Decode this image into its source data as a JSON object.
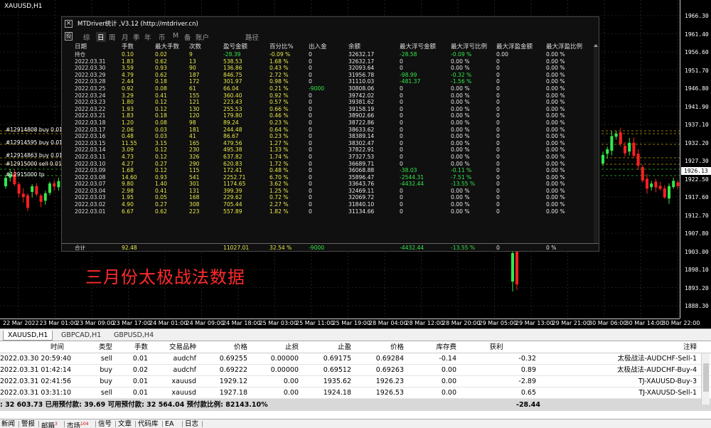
{
  "chart": {
    "symbol_title": "XAUUSD,H1",
    "caption": "三月份太极战法数据",
    "current_price": "1926.13",
    "price_ticks": [
      "1966.30",
      "1961.40",
      "1956.60",
      "1951.70",
      "1946.80",
      "1941.90",
      "1937.10",
      "1932.20",
      "1927.30",
      "1922.50",
      "1917.60",
      "1912.70",
      "1907.80",
      "1903.00",
      "1898.10",
      "1893.20",
      "1888.30"
    ],
    "time_ticks": [
      "22 Mar 2022",
      "23 Mar 01:00",
      "23 Mar 09:00",
      "23 Mar 17:00",
      "24 Mar 01:00",
      "24 Mar 09:00",
      "24 Mar 18:00",
      "25 Mar 03:00",
      "25 Mar 11:00",
      "25 Mar 19:00",
      "28 Mar 04:00",
      "28 Mar 12:00",
      "28 Mar 20:00",
      "29 Mar 05:00",
      "29 Mar 13:00",
      "29 Mar 21:00",
      "30 Mar 06:00",
      "30 Mar 14:00",
      "30 Mar 22:00"
    ],
    "order_labels": [
      "#12914808 buy 0.01",
      "#12914595 buy 0.01",
      "#12914863 buy 0.01",
      "#12915000 sell 0.01",
      "#12915000 tp"
    ]
  },
  "panel": {
    "title": "MTDriver统计 ,V3.12 (http://mtdriver.cn)",
    "side_box_top": "×",
    "side_box_tabs": "投",
    "tabs": [
      "综",
      "日",
      "周",
      "月",
      "季",
      "年",
      "币",
      "M",
      "备",
      "账户",
      "路径"
    ],
    "active_tab": "日",
    "headers": [
      "日期",
      "手数",
      "最大手数",
      "次数",
      "盈亏金额",
      "百分比%",
      "出入金",
      "余额",
      "最大浮亏金额",
      "最大浮亏比例",
      "最大浮盈金额",
      "最大浮盈比例"
    ],
    "rows": [
      [
        "持仓",
        "0.10",
        "0.02",
        "9",
        "-28.39",
        "-0.09 %",
        "0",
        "32632.17",
        "-28.58",
        "-0.09 %",
        "0.00",
        "0.00 %"
      ],
      [
        "2022.03.31",
        "1.83",
        "0.62",
        "13",
        "538.53",
        "1.68 %",
        "0",
        "32632.17",
        "0",
        "0.00 %",
        "0",
        "0.00 %"
      ],
      [
        "2022.03.30",
        "3.59",
        "0.93",
        "90",
        "136.86",
        "0.43 %",
        "0",
        "32093.64",
        "0",
        "0.00 %",
        "0",
        "0.00 %"
      ],
      [
        "2022.03.29",
        "4.79",
        "0.62",
        "187",
        "846.75",
        "2.72 %",
        "0",
        "31956.78",
        "-98.99",
        "-0.32 %",
        "0",
        "0.00 %"
      ],
      [
        "2022.03.28",
        "2.44",
        "0.18",
        "172",
        "301.97",
        "0.98 %",
        "0",
        "31110.03",
        "-481.37",
        "-1.56 %",
        "0",
        "0.00 %"
      ],
      [
        "2022.03.25",
        "0.92",
        "0.08",
        "61",
        "66.04",
        "0.21 %",
        "-9000",
        "30808.06",
        "0",
        "0.00 %",
        "0",
        "0.00 %"
      ],
      [
        "2022.03.24",
        "3.29",
        "0.41",
        "155",
        "360.40",
        "0.92 %",
        "0",
        "39742.02",
        "0",
        "0.00 %",
        "0",
        "0.00 %"
      ],
      [
        "2022.03.23",
        "1.80",
        "0.12",
        "121",
        "223.43",
        "0.57 %",
        "0",
        "39381.62",
        "0",
        "0.00 %",
        "0",
        "0.00 %"
      ],
      [
        "2022.03.22",
        "1.93",
        "0.12",
        "130",
        "255.53",
        "0.66 %",
        "0",
        "39158.19",
        "0",
        "0.00 %",
        "0",
        "0.00 %"
      ],
      [
        "2022.03.21",
        "1.83",
        "0.18",
        "120",
        "179.80",
        "0.46 %",
        "0",
        "38902.66",
        "0",
        "0.00 %",
        "0",
        "0.00 %"
      ],
      [
        "2022.03.18",
        "1.20",
        "0.08",
        "98",
        "89.24",
        "0.23 %",
        "0",
        "38722.86",
        "0",
        "0.00 %",
        "0",
        "0.00 %"
      ],
      [
        "2022.03.17",
        "2.06",
        "0.03",
        "181",
        "244.48",
        "0.64 %",
        "0",
        "38633.62",
        "0",
        "0.00 %",
        "0",
        "0.00 %"
      ],
      [
        "2022.03.16",
        "0.48",
        "0.03",
        "41",
        "86.67",
        "0.23 %",
        "0",
        "38389.14",
        "0",
        "0.00 %",
        "0",
        "0.00 %"
      ],
      [
        "2022.03.15",
        "11.55",
        "3.15",
        "165",
        "479.56",
        "1.27 %",
        "0",
        "38302.47",
        "0",
        "0.00 %",
        "0",
        "0.00 %"
      ],
      [
        "2022.03.14",
        "3.09",
        "0.12",
        "230",
        "495.38",
        "1.33 %",
        "0",
        "37822.91",
        "0",
        "0.00 %",
        "0",
        "0.00 %"
      ],
      [
        "2022.03.11",
        "4.73",
        "0.12",
        "326",
        "637.82",
        "1.74 %",
        "0",
        "37327.53",
        "0",
        "0.00 %",
        "0",
        "0.00 %"
      ],
      [
        "2022.03.10",
        "4.27",
        "0.27",
        "290",
        "620.83",
        "1.72 %",
        "0",
        "36689.71",
        "0",
        "0.00 %",
        "0",
        "0.00 %"
      ],
      [
        "2022.03.09",
        "1.68",
        "0.12",
        "115",
        "172.41",
        "0.48 %",
        "0",
        "36068.88",
        "-38.03",
        "-0.11 %",
        "0",
        "0.00 %"
      ],
      [
        "2022.03.08",
        "14.60",
        "0.93",
        "541",
        "2252.71",
        "6.70 %",
        "0",
        "35896.47",
        "-2544.31",
        "-7.51 %",
        "0",
        "0.00 %"
      ],
      [
        "2022.03.07",
        "9.80",
        "1.40",
        "301",
        "1174.65",
        "3.62 %",
        "0",
        "33643.76",
        "-4432.44",
        "-13.55 %",
        "0",
        "0.00 %"
      ],
      [
        "2022.03.04",
        "2.98",
        "0.41",
        "131",
        "399.39",
        "1.25 %",
        "0",
        "32469.11",
        "0",
        "0.00 %",
        "0",
        "0.00 %"
      ],
      [
        "2022.03.03",
        "1.95",
        "0.05",
        "168",
        "229.62",
        "0.72 %",
        "0",
        "32069.72",
        "0",
        "0.00 %",
        "0",
        "0.00 %"
      ],
      [
        "2022.03.02",
        "4.90",
        "0.27",
        "308",
        "705.44",
        "2.27 %",
        "0",
        "31840.10",
        "0",
        "0.00 %",
        "0",
        "0.00 %"
      ],
      [
        "2022.03.01",
        "6.67",
        "0.62",
        "223",
        "557.89",
        "1.82 %",
        "0",
        "31134.66",
        "0",
        "0.00 %",
        "0",
        "0.00 %"
      ]
    ],
    "total": [
      "合计",
      "92.48",
      "",
      "",
      "11027.01",
      "32.54 %",
      "-9000",
      "",
      "-4432.44",
      "-13.55 %",
      "0",
      "0 %"
    ]
  },
  "chart_tabs": [
    {
      "label": "XAUUSD,H1",
      "active": true
    },
    {
      "label": "GBPCAD,H1",
      "active": false
    },
    {
      "label": "GBPUSD,H4",
      "active": false
    }
  ],
  "trades": {
    "headers": [
      "时间",
      "类型",
      "手数",
      "交易品种",
      "价格",
      "止损",
      "止盈",
      "价格",
      "库存费",
      "获利",
      "注释"
    ],
    "rows": [
      [
        "2022.03.30 20:59:40",
        "sell",
        "0.01",
        "audchf",
        "0.69255",
        "0.00000",
        "0.69175",
        "0.69284",
        "-0.14",
        "-0.32",
        "太极战法-AUDCHF-Sell-1"
      ],
      [
        "2022.03.31 01:42:14",
        "buy",
        "0.02",
        "audchf",
        "0.69222",
        "0.00000",
        "0.69512",
        "0.69263",
        "0.00",
        "0.89",
        "太极战法-AUDCHF-Buy-4"
      ],
      [
        "2022.03.31 02:41:56",
        "buy",
        "0.01",
        "xauusd",
        "1929.12",
        "0.00",
        "1935.62",
        "1926.23",
        "0.00",
        "-2.89",
        "TJ-XAUUSD-Buy-3"
      ],
      [
        "2022.03.31 03:31:10",
        "sell",
        "0.01",
        "xauusd",
        "1927.18",
        "0.00",
        "1924.18",
        "1926.53",
        "0.00",
        "0.65",
        "TJ-XAUUSD-Sell-1"
      ]
    ],
    "summary_left": ": 32 603.73  已用预付款: 39.69  可用预付款: 32 564.04  预付款比例: 82143.10%",
    "summary_profit": "-28.44"
  },
  "bottom_tabs": [
    {
      "label": "新闻"
    },
    {
      "label": "警报"
    },
    {
      "label": "邮箱",
      "badge": "3"
    },
    {
      "label": "市场",
      "badge": "104"
    },
    {
      "label": "信号"
    },
    {
      "label": "文章"
    },
    {
      "label": "代码库"
    },
    {
      "label": "EA"
    },
    {
      "label": "日志"
    }
  ],
  "colors": {
    "bull": "#33e84a",
    "bear": "#ff2020",
    "grid": "#3a3a3a",
    "caption": "#ff2a2a"
  }
}
